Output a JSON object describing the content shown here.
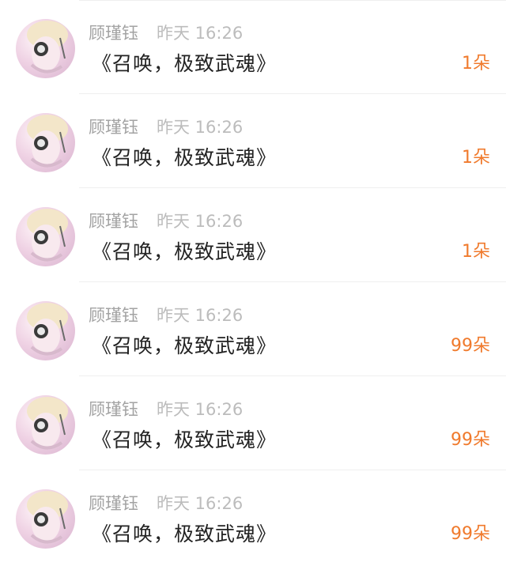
{
  "messages": [
    {
      "user": "顾瑾钰",
      "time": "昨天 16:26",
      "title": "《召唤，极致武魂》",
      "gift": "1朵"
    },
    {
      "user": "顾瑾钰",
      "time": "昨天 16:26",
      "title": "《召唤，极致武魂》",
      "gift": "1朵"
    },
    {
      "user": "顾瑾钰",
      "time": "昨天 16:26",
      "title": "《召唤，极致武魂》",
      "gift": "1朵"
    },
    {
      "user": "顾瑾钰",
      "time": "昨天 16:26",
      "title": "《召唤，极致武魂》",
      "gift": "99朵"
    },
    {
      "user": "顾瑾钰",
      "time": "昨天 16:26",
      "title": "《召唤，极致武魂》",
      "gift": "99朵"
    },
    {
      "user": "顾瑾钰",
      "time": "昨天 16:26",
      "title": "《召唤，极致武魂》",
      "gift": "99朵"
    }
  ],
  "colors": {
    "username": "#a3a3a3",
    "timestamp": "#bcbcbc",
    "title": "#222222",
    "gift_count": "#f07a2c",
    "divider": "#efefef"
  },
  "icons": {
    "avatar": "user-avatar-photo"
  }
}
